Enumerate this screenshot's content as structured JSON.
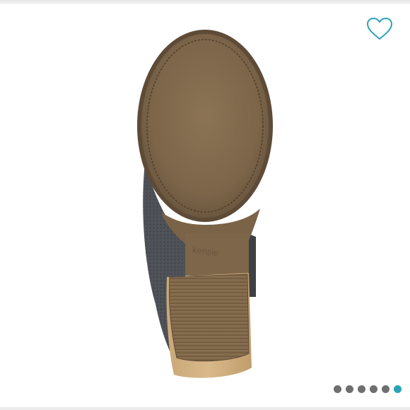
{
  "product": {
    "brand_logo_text": "kensie"
  },
  "like": {
    "icon": "heart-outline-icon",
    "color": "#2aa3b8"
  },
  "carousel": {
    "total": 6,
    "current": 6,
    "dot_color": "#6f6f6f",
    "active_color": "#2aa3b8"
  }
}
